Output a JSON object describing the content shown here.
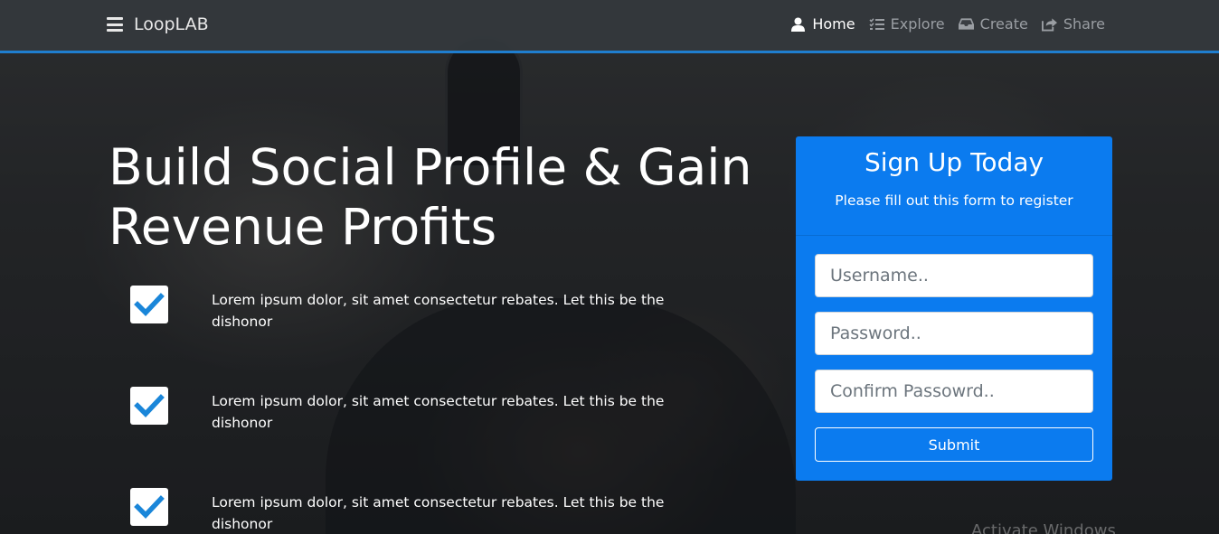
{
  "navbar": {
    "brand": "LoopLAB",
    "items": [
      {
        "label": "Home",
        "icon": "user-icon",
        "active": true
      },
      {
        "label": "Explore",
        "icon": "list-icon",
        "active": false
      },
      {
        "label": "Create",
        "icon": "inbox-icon",
        "active": false
      },
      {
        "label": "Share",
        "icon": "share-icon",
        "active": false
      }
    ]
  },
  "hero": {
    "title": "Build Social Profile & Gain Revenue Profits",
    "features": [
      {
        "text": "Lorem ipsum dolor, sit amet consectetur rebates. Let this be the dishonor",
        "icon": "check-icon"
      },
      {
        "text": "Lorem ipsum dolor, sit amet consectetur rebates. Let this be the dishonor",
        "icon": "check-icon"
      },
      {
        "text": "Lorem ipsum dolor, sit amet consectetur rebates. Let this be the dishonor",
        "icon": "check-icon"
      }
    ]
  },
  "signup": {
    "title": "Sign Up Today",
    "subtitle": "Please fill out this form to register",
    "username_placeholder": "Username..",
    "password_placeholder": "Password..",
    "confirm_placeholder": "Confirm Passowrd..",
    "submit_label": "Submit"
  },
  "system": {
    "watermark": "Activate Windows"
  },
  "colors": {
    "accent": "#0b7bef",
    "navbar_border": "#1f7ecf",
    "check": "#1a86d9"
  }
}
